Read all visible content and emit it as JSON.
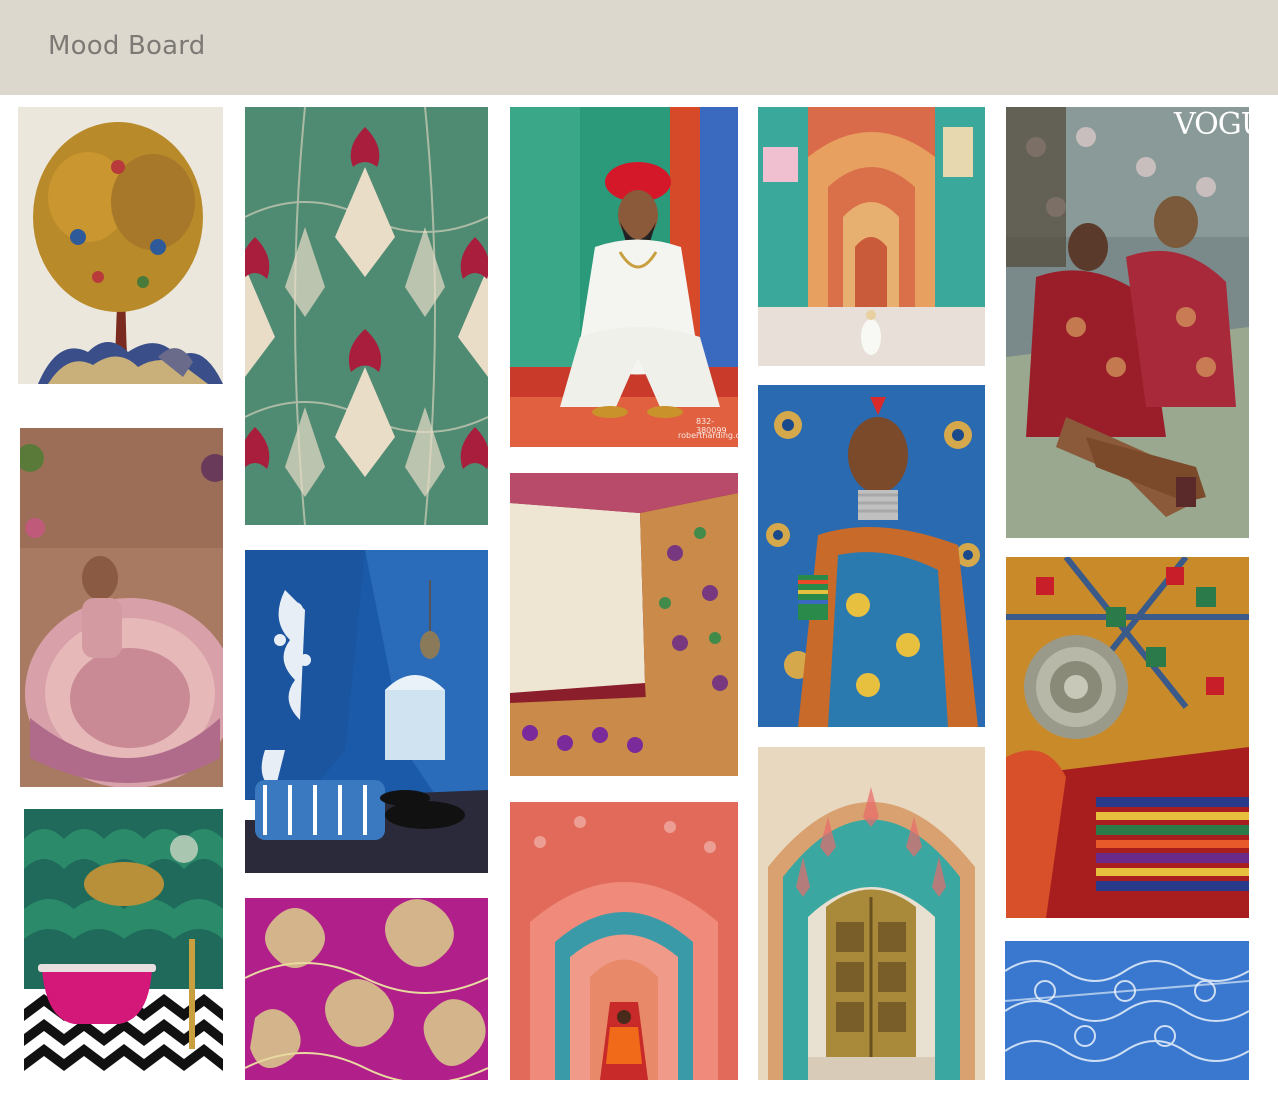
{
  "header": {
    "title": "Mood Board"
  },
  "tiles": [
    {
      "name": "tree-of-life-embroidery",
      "text": ""
    },
    {
      "name": "lotus-wallpaper-green",
      "text": ""
    },
    {
      "name": "rajasthani-man-turban",
      "text": ""
    },
    {
      "name": "patrika-gate-corridor",
      "text": ""
    },
    {
      "name": "vogue-editorial-women",
      "text": "VOGUE"
    },
    {
      "name": "bride-pink-lehenga",
      "text": ""
    },
    {
      "name": "blue-palace-corridor",
      "text": ""
    },
    {
      "name": "paithani-saree",
      "text": ""
    },
    {
      "name": "peacock-woman-portrait",
      "text": ""
    },
    {
      "name": "embroidered-textile-jewelry",
      "text": ""
    },
    {
      "name": "pink-bathtub-room",
      "text": ""
    },
    {
      "name": "magenta-brocade",
      "text": ""
    },
    {
      "name": "pink-arched-corridor",
      "text": ""
    },
    {
      "name": "lotus-gate-door",
      "text": ""
    },
    {
      "name": "blue-ceiling-pattern",
      "text": ""
    }
  ],
  "watermarks": {
    "robertharding": "robertharding.com",
    "stock_id": "832-380099"
  },
  "colors": {
    "header_bg": "#ddd8ce",
    "title_color": "#7d7a76"
  }
}
